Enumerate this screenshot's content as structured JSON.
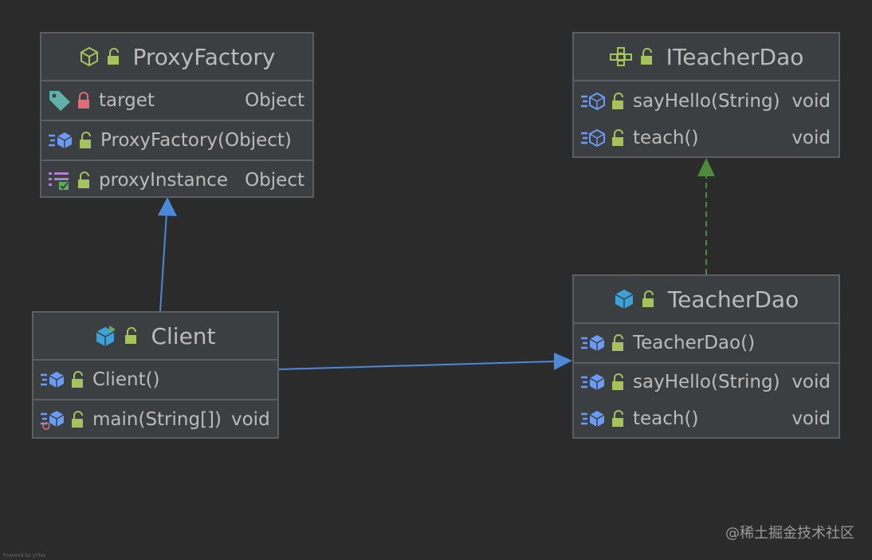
{
  "classes": {
    "proxy_factory": {
      "name": "ProxyFactory",
      "fields": [
        {
          "name": "target",
          "type": "Object"
        }
      ],
      "constructors": [
        {
          "name": "ProxyFactory(Object)",
          "type": ""
        }
      ],
      "methods": [
        {
          "name": "proxyInstance",
          "type": "Object"
        }
      ]
    },
    "iteacher_dao": {
      "name": "ITeacherDao",
      "methods": [
        {
          "name": "sayHello(String)",
          "type": "void"
        },
        {
          "name": "teach()",
          "type": "void"
        }
      ]
    },
    "client": {
      "name": "Client",
      "constructors": [
        {
          "name": "Client()",
          "type": ""
        }
      ],
      "methods": [
        {
          "name": "main(String[])",
          "type": "void"
        }
      ]
    },
    "teacher_dao": {
      "name": "TeacherDao",
      "constructors": [
        {
          "name": "TeacherDao()",
          "type": ""
        }
      ],
      "methods": [
        {
          "name": "sayHello(String)",
          "type": "void"
        },
        {
          "name": "teach()",
          "type": "void"
        }
      ]
    }
  },
  "edges": [
    {
      "from": "Client",
      "to": "ProxyFactory",
      "kind": "dependency",
      "color": "#4a88d9"
    },
    {
      "from": "Client",
      "to": "TeacherDao",
      "kind": "dependency",
      "color": "#4a88d9"
    },
    {
      "from": "TeacherDao",
      "to": "ITeacherDao",
      "kind": "realization",
      "color": "#4e8a3c"
    }
  ],
  "colors": {
    "background": "#2b2b2b",
    "node_fill": "#3c3f41",
    "node_border": "#5b5f62",
    "dependency_arrow": "#4a88d9",
    "realization_arrow": "#4e8a3c",
    "public_lock": "#a5c25c",
    "private_lock": "#e06c75",
    "method_icon": "#6b9cf5"
  },
  "watermark": "@稀土掘金技术社区",
  "footer": "Powered by yFiles"
}
